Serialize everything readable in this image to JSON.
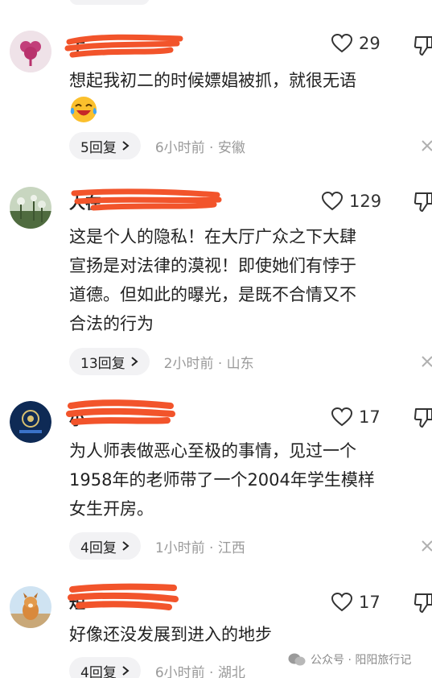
{
  "comments": [
    {
      "username": "丁",
      "likes": "29",
      "text_lines": [
        "想起我初二的时候嫖娼被抓，就很无语"
      ],
      "emoji": "sweat-laugh-emoji",
      "reply_label": "5回复",
      "meta": "6小时前 · 安徽"
    },
    {
      "username": "人在",
      "likes": "129",
      "text_lines": [
        "这是个人的隐私！在大厅广众之下大肆",
        "宣扬是对法律的漠视！即使她们有悖于",
        "道德。但如此的曝光，是既不合情又不",
        "合法的行为"
      ],
      "reply_label": "13回复",
      "meta": "2小时前 · 山东"
    },
    {
      "username": "小",
      "likes": "17",
      "text_lines": [
        "为人师表做恶心至极的事情，见过一个",
        "1958年的老师带了一个2004年学生模样",
        "女生开房。"
      ],
      "reply_label": "4回复",
      "meta": "1小时前 · 江西"
    },
    {
      "username": "短",
      "likes": "17",
      "text_lines": [
        "好像还没发展到进入的地步"
      ],
      "reply_label": "4回复",
      "meta": "6小时前 · 湖北"
    }
  ],
  "watermark": "公众号 · 阳阳旅行记",
  "colors": {
    "scribble": "#f2542b",
    "muted": "#9a9a9a",
    "pill": "#f2f2f4"
  }
}
